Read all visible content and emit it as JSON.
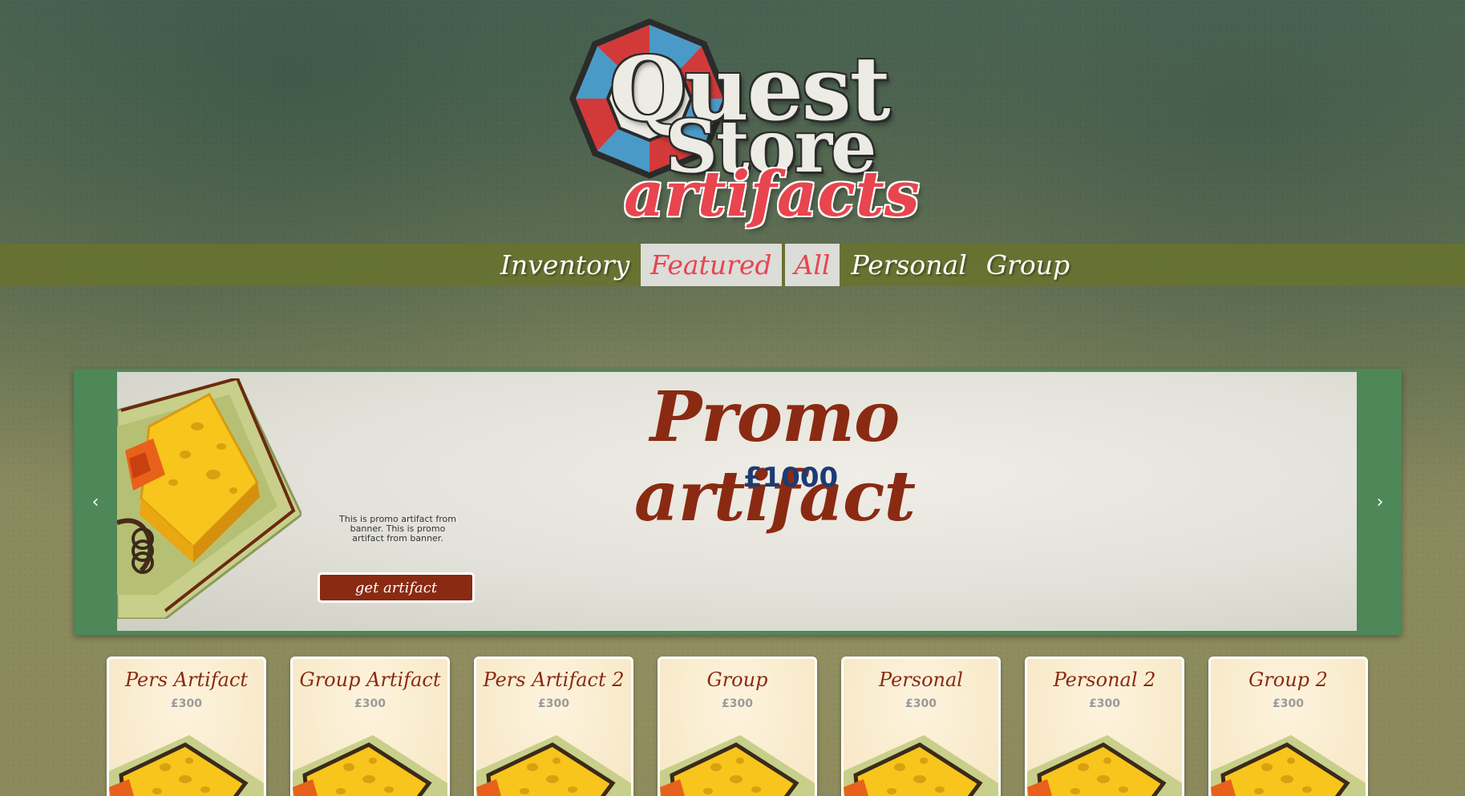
{
  "logo": {
    "line1": "Quest",
    "line2": "Store",
    "subtitle": "artifacts"
  },
  "nav": {
    "items": [
      {
        "label": "Inventory",
        "active": false
      },
      {
        "label": "Featured",
        "active": true
      },
      {
        "label": "All",
        "active": true
      },
      {
        "label": "Personal",
        "active": false
      },
      {
        "label": "Group",
        "active": false
      }
    ]
  },
  "banner": {
    "title": "Promo artifact",
    "price": "£1000",
    "description": "This is promo artifact from banner. This is promo artifact from banner.",
    "button_label": "get artifact",
    "prev_arrow": "‹",
    "next_arrow": "›"
  },
  "cards": [
    {
      "title": "Pers Artifact",
      "price": "£300"
    },
    {
      "title": "Group Artifact",
      "price": "£300"
    },
    {
      "title": "Pers Artifact 2",
      "price": "£300"
    },
    {
      "title": "Group",
      "price": "£300"
    },
    {
      "title": "Personal",
      "price": "£300"
    },
    {
      "title": "Personal 2",
      "price": "£300"
    },
    {
      "title": "Group 2",
      "price": "£300"
    }
  ],
  "colors": {
    "accent_red": "#e8454f",
    "title_brown": "#8a2a12",
    "price_blue": "#1c3b74",
    "banner_green": "#4e8758",
    "nav_olive": "#69732d"
  },
  "icons": {
    "prev": "chevron-left-icon",
    "next": "chevron-right-icon",
    "artifact_image": "mousetrap-cheese-image"
  }
}
